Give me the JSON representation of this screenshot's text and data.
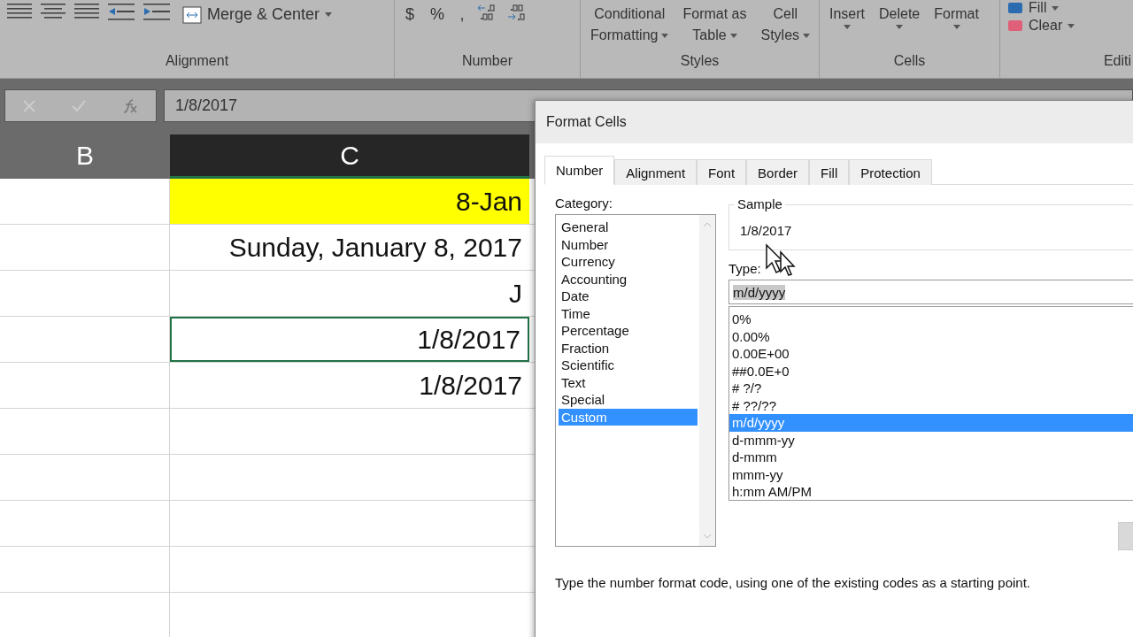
{
  "ribbon": {
    "alignment": {
      "merge_button": "Merge & Center",
      "label": "Alignment"
    },
    "number": {
      "symbols": [
        "$",
        "%",
        "‚"
      ],
      "label": "Number"
    },
    "styles": {
      "buttons": [
        {
          "lines": [
            "Conditional",
            "Formatting"
          ]
        },
        {
          "lines": [
            "Format as",
            "Table"
          ]
        },
        {
          "lines": [
            "Cell",
            "Styles"
          ]
        }
      ],
      "label": "Styles"
    },
    "cells": {
      "buttons": [
        "Insert",
        "Delete",
        "Format"
      ],
      "label": "Cells"
    },
    "editing": {
      "buttons": [
        "Fill",
        "Clear"
      ],
      "label": "Editi"
    }
  },
  "formula_bar": {
    "value": "1/8/2017"
  },
  "sheet": {
    "columns": [
      {
        "label": "B",
        "selected": false
      },
      {
        "label": "C",
        "selected": true
      }
    ],
    "rows": [
      {
        "c": "8-Jan",
        "highlighted": true,
        "selected": false
      },
      {
        "c": "Sunday, January 8, 2017",
        "highlighted": false,
        "selected": false
      },
      {
        "c": "J",
        "highlighted": false,
        "selected": false
      },
      {
        "c": "1/8/2017",
        "highlighted": false,
        "selected": true
      },
      {
        "c": "1/8/2017",
        "highlighted": false,
        "selected": false
      }
    ]
  },
  "dialog": {
    "title": "Format Cells",
    "tabs": [
      {
        "label": "Number",
        "selected": true
      },
      {
        "label": "Alignment",
        "selected": false
      },
      {
        "label": "Font",
        "selected": false
      },
      {
        "label": "Border",
        "selected": false
      },
      {
        "label": "Fill",
        "selected": false
      },
      {
        "label": "Protection",
        "selected": false
      }
    ],
    "category_label": "Category:",
    "categories": [
      {
        "label": "General",
        "selected": false
      },
      {
        "label": "Number",
        "selected": false
      },
      {
        "label": "Currency",
        "selected": false
      },
      {
        "label": "Accounting",
        "selected": false
      },
      {
        "label": "Date",
        "selected": false
      },
      {
        "label": "Time",
        "selected": false
      },
      {
        "label": "Percentage",
        "selected": false
      },
      {
        "label": "Fraction",
        "selected": false
      },
      {
        "label": "Scientific",
        "selected": false
      },
      {
        "label": "Text",
        "selected": false
      },
      {
        "label": "Special",
        "selected": false
      },
      {
        "label": "Custom",
        "selected": true
      }
    ],
    "sample_label": "Sample",
    "sample_value": "1/8/2017",
    "type_label": "Type:",
    "type_value": "m/d/yyyy",
    "types": [
      {
        "label": "0%",
        "selected": false
      },
      {
        "label": "0.00%",
        "selected": false
      },
      {
        "label": "0.00E+00",
        "selected": false
      },
      {
        "label": "##0.0E+0",
        "selected": false
      },
      {
        "label": "# ?/?",
        "selected": false
      },
      {
        "label": "# ??/??",
        "selected": false
      },
      {
        "label": "m/d/yyyy",
        "selected": true
      },
      {
        "label": "d-mmm-yy",
        "selected": false
      },
      {
        "label": "d-mmm",
        "selected": false
      },
      {
        "label": "mmm-yy",
        "selected": false
      },
      {
        "label": "h:mm AM/PM",
        "selected": false
      }
    ],
    "description": "Type the number format code, using one of the existing codes as a starting point."
  }
}
